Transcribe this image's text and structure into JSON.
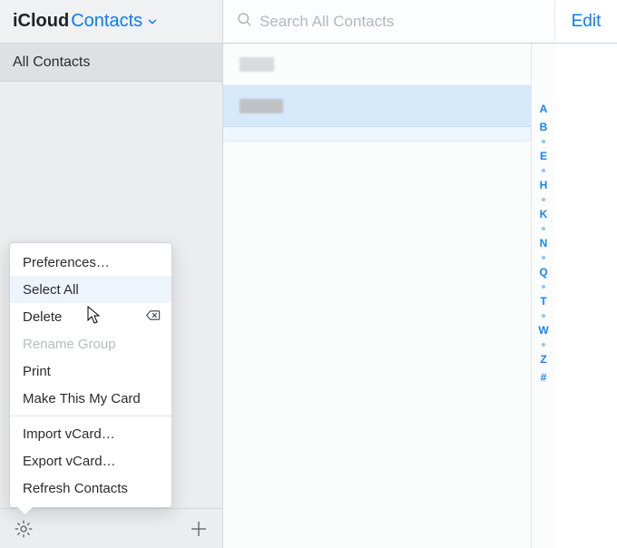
{
  "header": {
    "app": "iCloud",
    "section": "Contacts",
    "search_placeholder": "Search All Contacts",
    "edit_label": "Edit"
  },
  "sidebar": {
    "groups": [
      {
        "label": "All Contacts",
        "selected": true
      }
    ]
  },
  "settings_menu": {
    "items": [
      {
        "id": "preferences",
        "label": "Preferences…"
      },
      {
        "id": "select_all",
        "label": "Select All",
        "hover": true
      },
      {
        "id": "delete",
        "label": "Delete",
        "trailing_icon": "delete-key-icon"
      },
      {
        "id": "rename_group",
        "label": "Rename Group",
        "disabled": true
      },
      {
        "id": "print",
        "label": "Print"
      },
      {
        "id": "make_my_card",
        "label": "Make This My Card"
      },
      {
        "sep": true
      },
      {
        "id": "import_vcard",
        "label": "Import vCard…"
      },
      {
        "id": "export_vcard",
        "label": "Export vCard…"
      },
      {
        "id": "refresh",
        "label": "Refresh Contacts"
      }
    ]
  },
  "alpha_index": [
    "A",
    "B",
    "•",
    "E",
    "•",
    "H",
    "•",
    "K",
    "•",
    "N",
    "•",
    "Q",
    "•",
    "T",
    "•",
    "W",
    "•",
    "Z",
    "#"
  ],
  "colors": {
    "accent": "#0a7bff"
  }
}
